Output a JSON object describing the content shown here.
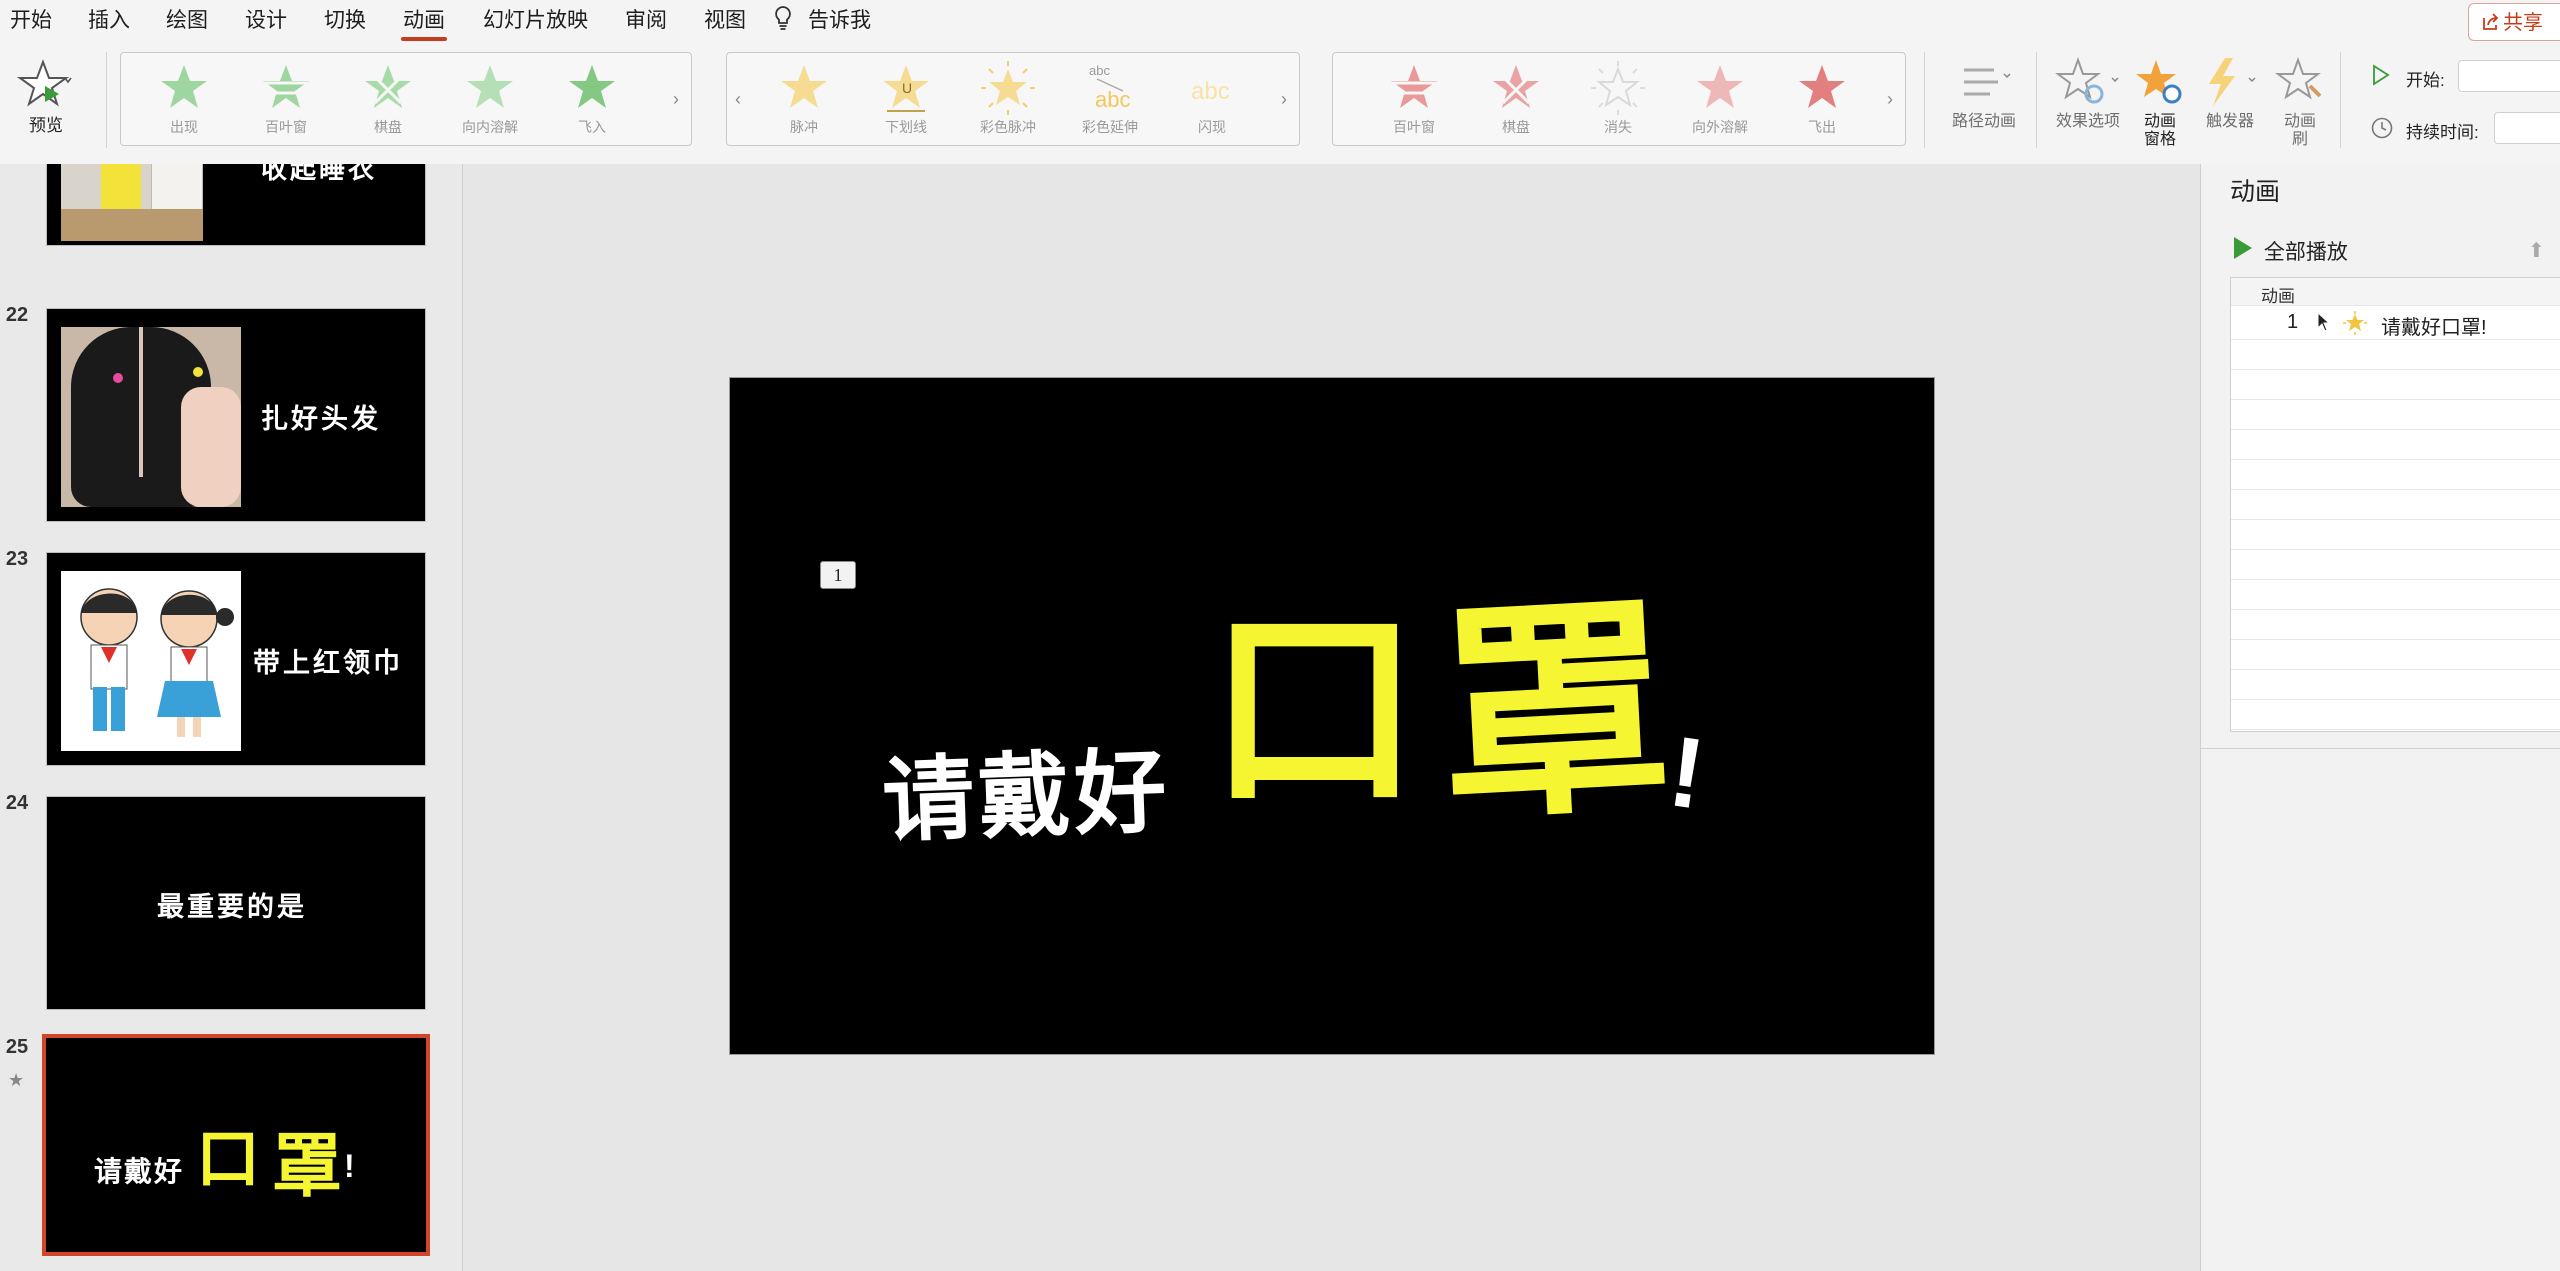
{
  "menu": {
    "tabs": [
      "开始",
      "插入",
      "绘图",
      "设计",
      "切换",
      "动画",
      "幻灯片放映",
      "审阅",
      "视图"
    ],
    "tell_me": "告诉我",
    "share": "共享"
  },
  "ribbon": {
    "preview": "预览",
    "entrance": [
      "出现",
      "百叶窗",
      "棋盘",
      "向内溶解",
      "飞入"
    ],
    "emphasis": [
      "脉冲",
      "下划线",
      "彩色脉冲",
      "彩色延伸",
      "闪现"
    ],
    "exit": [
      "百叶窗",
      "棋盘",
      "消失",
      "向外溶解",
      "飞出"
    ],
    "path": "路径动画",
    "effect_options": "效果选项",
    "anim_pane_l1": "动画",
    "anim_pane_l2": "窗格",
    "trigger": "触发器",
    "painter_l1": "动画",
    "painter_l2": "刷",
    "start_label": "开始:",
    "duration_label": "持续时间:"
  },
  "thumbs": {
    "s21_text": "收起睡衣",
    "s22_num": "22",
    "s22_text": "扎好头发",
    "s23_num": "23",
    "s23_text": "带上红领巾",
    "s24_num": "24",
    "s24_text": "最重要的是",
    "s25_num": "25",
    "s25_text1": "请戴好",
    "s25_text2": "口",
    "s25_text3": "罩",
    "s25_text4": "!"
  },
  "slide": {
    "badge": "1",
    "text1": "请戴好",
    "text2": "口",
    "text3": "罩",
    "text4": "!"
  },
  "pane": {
    "title": "动画",
    "play_all": "全部播放",
    "column": "动画",
    "item_index": "1",
    "item_text": "请戴好口罩!"
  },
  "colors": {
    "accent": "#c43e1c",
    "yellow": "#f5f531",
    "entrance_green": "#8fcf8f",
    "emphasis_gold": "#f2d27a",
    "exit_red": "#e48a8a"
  }
}
